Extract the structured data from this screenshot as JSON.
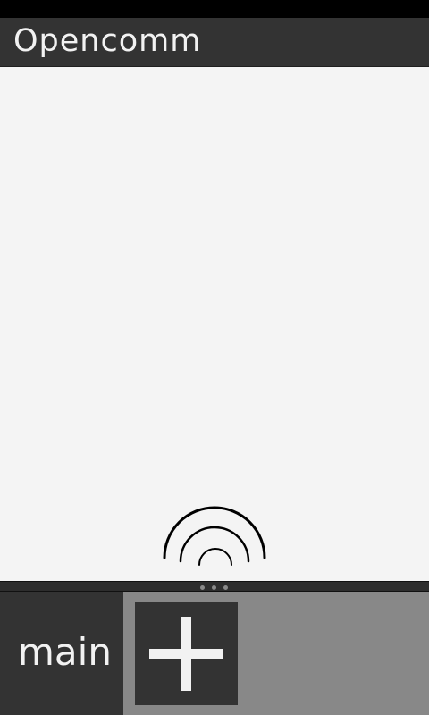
{
  "app": {
    "title": "Opencomm"
  },
  "main": {
    "status_icon": "signal-arcs-icon"
  },
  "bottom_bar": {
    "tabs": [
      {
        "label": "main"
      }
    ],
    "add_button_icon": "plus-icon"
  },
  "colors": {
    "title_bar": "#333333",
    "content_background": "#f4f4f4",
    "bottom_bar": "#888888",
    "tab": "#333333",
    "text": "#f2f2f2"
  }
}
